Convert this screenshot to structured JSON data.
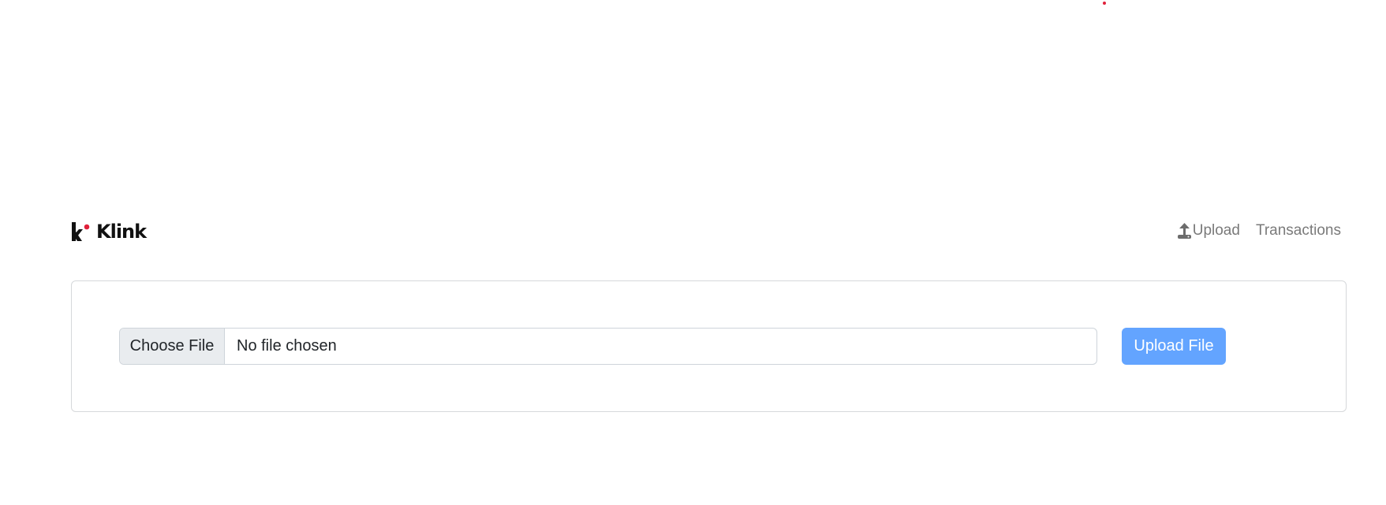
{
  "colors": {
    "accent": "#63a4ff",
    "brand_dot": "#e0203a",
    "nav_text": "#7a7a7a",
    "border": "#d6d8db"
  },
  "header": {
    "brand_name": "Klink",
    "brand_icon": "klink-logo",
    "nav": [
      {
        "label": "Upload",
        "icon": "upload-icon"
      },
      {
        "label": "Transactions"
      }
    ]
  },
  "upload_form": {
    "file_input": {
      "button_label": "Choose File",
      "status_text": "No file chosen"
    },
    "submit_label": "Upload File"
  }
}
